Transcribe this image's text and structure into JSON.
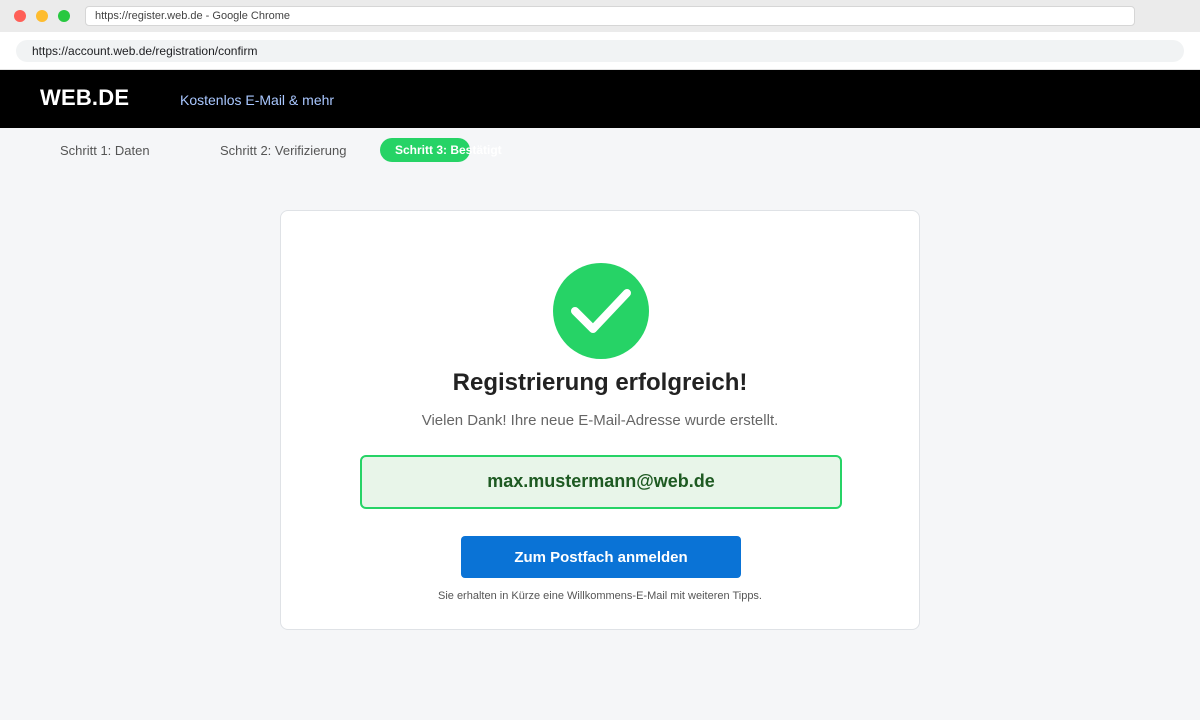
{
  "window": {
    "title": "https://register.web.de - Google Chrome"
  },
  "browser": {
    "url": "https://account.web.de/registration/confirm"
  },
  "header": {
    "logo": "WEB.DE",
    "tagline": "Kostenlos E-Mail & mehr"
  },
  "steps": [
    {
      "label": "Schritt 1: Daten",
      "active": false
    },
    {
      "label": "Schritt 2: Verifizierung",
      "active": false
    },
    {
      "label": "Schritt 3: Bestätigt",
      "active": true
    }
  ],
  "confirmation": {
    "icon": "checkmark-icon",
    "headline": "Registrierung erfolgreich!",
    "message": "Vielen Dank! Ihre neue E-Mail-Adresse wurde erstellt.",
    "email": "max.mustermann@web.de",
    "button_label": "Zum Postfach anmelden",
    "footnote": "Sie erhalten in Kürze eine Willkommens-E-Mail mit weiteren Tipps."
  },
  "colors": {
    "accent_green": "#26d366",
    "button_blue": "#0a73d6",
    "header_black": "#000000",
    "tagline_blue": "#a9c7ff"
  }
}
